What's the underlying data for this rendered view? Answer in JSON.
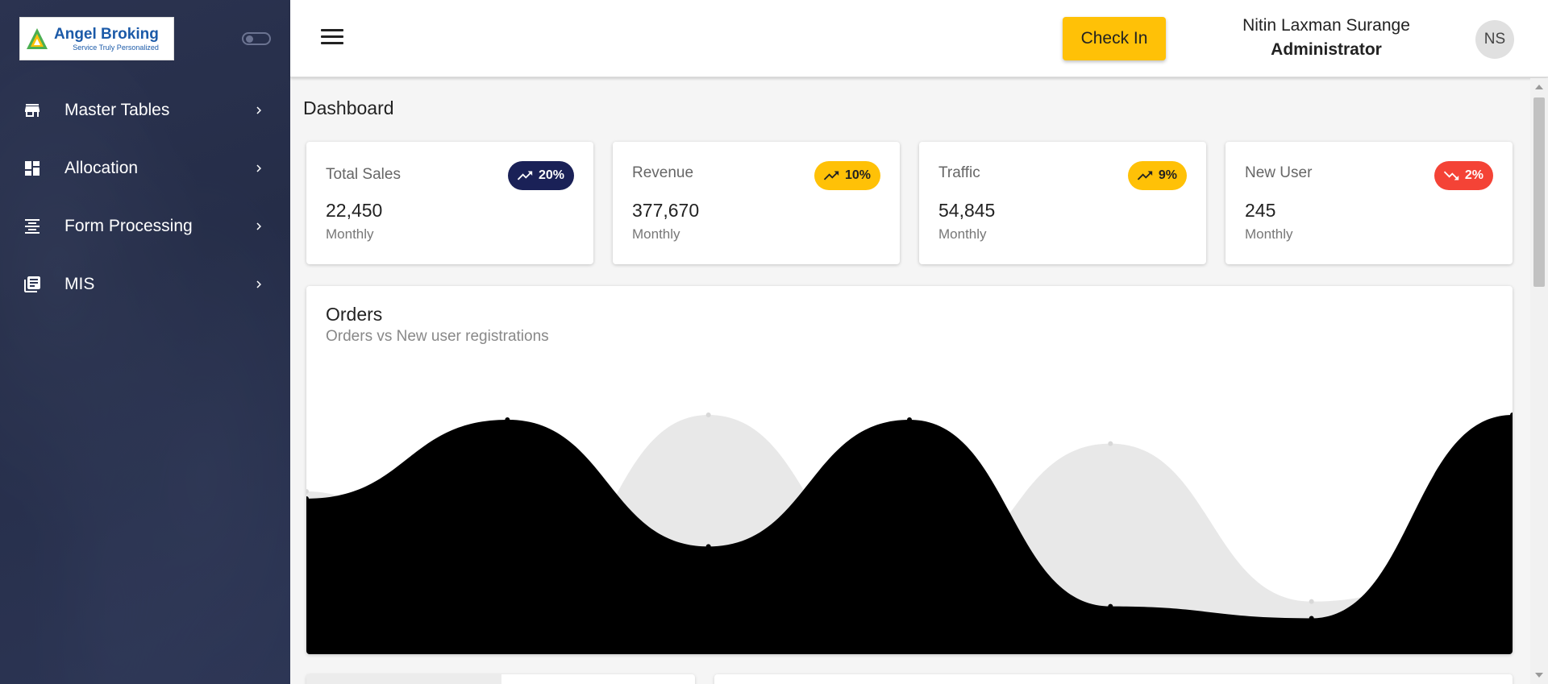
{
  "brand": {
    "name": "Angel Broking",
    "tagline": "Service Truly Personalized"
  },
  "sidebar": {
    "items": [
      {
        "label": "Master Tables",
        "icon": "store-icon"
      },
      {
        "label": "Allocation",
        "icon": "dashboard-icon"
      },
      {
        "label": "Form Processing",
        "icon": "align-center-icon"
      },
      {
        "label": "MIS",
        "icon": "library-books-icon"
      }
    ]
  },
  "header": {
    "checkin_label": "Check In",
    "user_name": "Nitin Laxman Surange",
    "user_role": "Administrator",
    "avatar_initials": "NS"
  },
  "page": {
    "title": "Dashboard"
  },
  "stats": [
    {
      "title": "Total Sales",
      "value": "22,450",
      "period": "Monthly",
      "change": "20%",
      "trend": "up",
      "badge_color": "#1a2157",
      "badge_text_color": "#ffffff"
    },
    {
      "title": "Revenue",
      "value": "377,670",
      "period": "Monthly",
      "change": "10%",
      "trend": "up",
      "badge_color": "#ffc107",
      "badge_text_color": "#222222"
    },
    {
      "title": "Traffic",
      "value": "54,845",
      "period": "Monthly",
      "change": "9%",
      "trend": "up",
      "badge_color": "#ffc107",
      "badge_text_color": "#222222"
    },
    {
      "title": "New User",
      "value": "245",
      "period": "Monthly",
      "change": "2%",
      "trend": "down",
      "badge_color": "#f44336",
      "badge_text_color": "#ffffff"
    }
  ],
  "chart_data": {
    "type": "area",
    "title": "Orders",
    "subtitle": "Orders vs New user registrations",
    "x": [
      0,
      1,
      2,
      3,
      4,
      5,
      6
    ],
    "ylim": [
      0,
      100
    ],
    "series": [
      {
        "values": [
          65,
          98,
          45,
          98,
          20,
          15,
          100
        ],
        "color": "#000000"
      },
      {
        "values": [
          68,
          20,
          100,
          30,
          88,
          22,
          40
        ],
        "color": "#e8e8e8"
      }
    ]
  }
}
